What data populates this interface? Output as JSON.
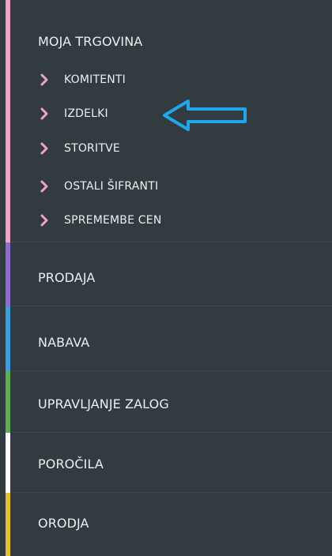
{
  "colors": {
    "background": "#323c40",
    "text": "#eceff0",
    "chevron": "#f0a3c4",
    "annotation_arrow": "#1ea7ea",
    "accent_moja_trgovina": "#f0a3c4",
    "accent_prodaja": "#8e6bd1",
    "accent_nabava": "#3a9ee4",
    "accent_upravljanje_zalog": "#5bb04f",
    "accent_porocila": "#ffffff",
    "accent_orodja": "#e7c12a"
  },
  "menu": {
    "moja_trgovina": {
      "label": "MOJA TRGOVINA",
      "items": [
        {
          "label": "KOMITENTI",
          "icon": "chevron-right-icon"
        },
        {
          "label": "IZDELKI",
          "icon": "chevron-right-icon"
        },
        {
          "label": "STORITVE",
          "icon": "chevron-right-icon"
        },
        {
          "label": "OSTALI ŠIFRANTI",
          "icon": "chevron-right-icon"
        },
        {
          "label": "SPREMEMBE CEN",
          "icon": "chevron-right-icon"
        }
      ]
    },
    "prodaja": {
      "label": "PRODAJA"
    },
    "nabava": {
      "label": "NABAVA"
    },
    "upravljanje_zalog": {
      "label": "UPRAVLJANJE ZALOG"
    },
    "porocila": {
      "label": "POROČILA"
    },
    "orodja": {
      "label": "ORODJA"
    }
  },
  "annotation": {
    "icon": "arrow-left-icon",
    "points_to": "IZDELKI"
  }
}
